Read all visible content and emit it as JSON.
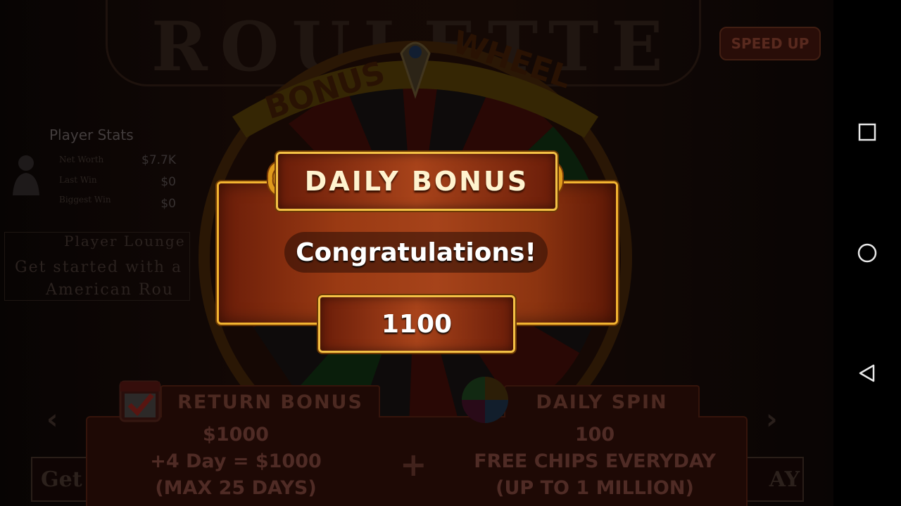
{
  "background": {
    "title": "ROULETTE",
    "speed_up_label": "SPEED UP",
    "wheel_title": "BONUS WHEEL"
  },
  "player_stats": {
    "title": "Player Stats",
    "rows": [
      {
        "label": "Net Worth",
        "value": "$7.7K"
      },
      {
        "label": "Last Win",
        "value": "$0"
      },
      {
        "label": "Biggest Win",
        "value": "$0"
      }
    ]
  },
  "player_lounge": {
    "title": "Player Lounge",
    "text_line1": "Get started with a",
    "text_line2": "American Rou"
  },
  "bottom": {
    "return_bonus": {
      "tab_label": "RETURN BONUS",
      "line1": "$1000",
      "line2": "+4 Day = $1000",
      "line3": "(MAX 25 DAYS)"
    },
    "plus": "+",
    "daily_spin": {
      "tab_label": "DAILY SPIN",
      "line1": "100",
      "line2": "FREE CHIPS EVERYDAY",
      "line3": "(UP TO 1 MILLION)"
    },
    "left_button_text": "Get",
    "right_button_text": "AY"
  },
  "modal": {
    "title": "DAILY BONUS",
    "message": "Congratulations!",
    "amount": "1100"
  },
  "colors": {
    "modal_border": "#f3b431",
    "modal_wood": "#a6431a",
    "header_text": "#fff3cf"
  },
  "icons": {
    "nav_recent": "square-icon",
    "nav_home": "circle-icon",
    "nav_back": "triangle-back-icon"
  }
}
